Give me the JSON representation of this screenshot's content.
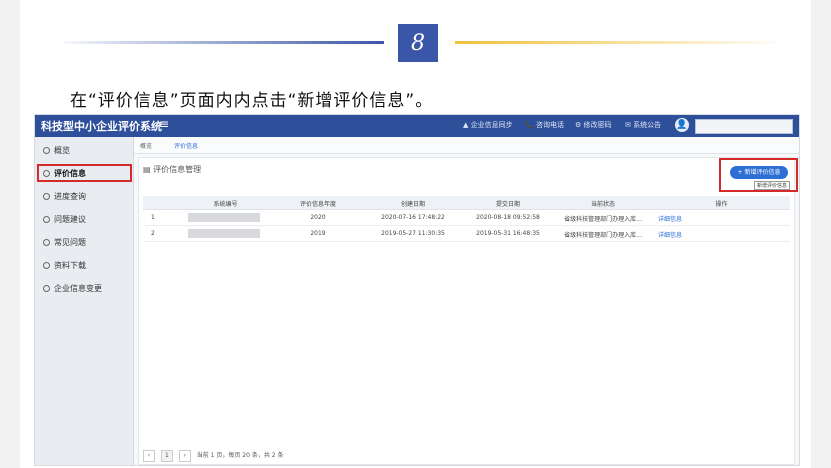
{
  "step": {
    "number": "8"
  },
  "instruction": "在“评价信息”页面内内点击“新增评价信息”。",
  "app": {
    "title": "科技型中小企业评价系统",
    "menu_icon": "≡",
    "topbar": {
      "sync": "▲ 企业信息同步",
      "hotline": "📞 咨询电话",
      "password": "⚙ 修改密码",
      "notice": "✉ 系统公告",
      "avatar": "👤"
    },
    "sidebar": {
      "items": [
        {
          "label": "概览"
        },
        {
          "label": "评价信息"
        },
        {
          "label": "进度查询"
        },
        {
          "label": "问题建议"
        },
        {
          "label": "常见问题"
        },
        {
          "label": "资料下载"
        },
        {
          "label": "企业信息变更"
        }
      ]
    },
    "tabs": {
      "first": "概览",
      "second": "评价信息"
    },
    "panel": {
      "title": "▤ 评价信息管理",
      "add_button": "+ 新增评价信息",
      "add_tooltip": "新增评价信息"
    },
    "table": {
      "headers": [
        "",
        "系统编号",
        "评价信息年度",
        "创建日期",
        "提交日期",
        "当前状态",
        "操作"
      ],
      "rows": [
        {
          "index": "1",
          "year": "2020",
          "created": "2020-07-16 17:48:22",
          "submitted": "2020-08-18 09:52:58",
          "status": "省级科技管理部门办理入库...",
          "action": "详细信息"
        },
        {
          "index": "2",
          "year": "2019",
          "created": "2019-05-27 11:30:35",
          "submitted": "2019-05-31 16:48:35",
          "status": "省级科技管理部门办理入库...",
          "action": "详细信息"
        }
      ]
    },
    "pager": {
      "prev": "‹",
      "current": "1",
      "next": "›",
      "summary": "当前 1 页，每页 20 条，共 2 条"
    }
  },
  "colors": {
    "brand": "#2e4f9a",
    "accent": "#2e6fd6",
    "highlight": "#d42a2a",
    "step_box": "#3a56a8"
  }
}
